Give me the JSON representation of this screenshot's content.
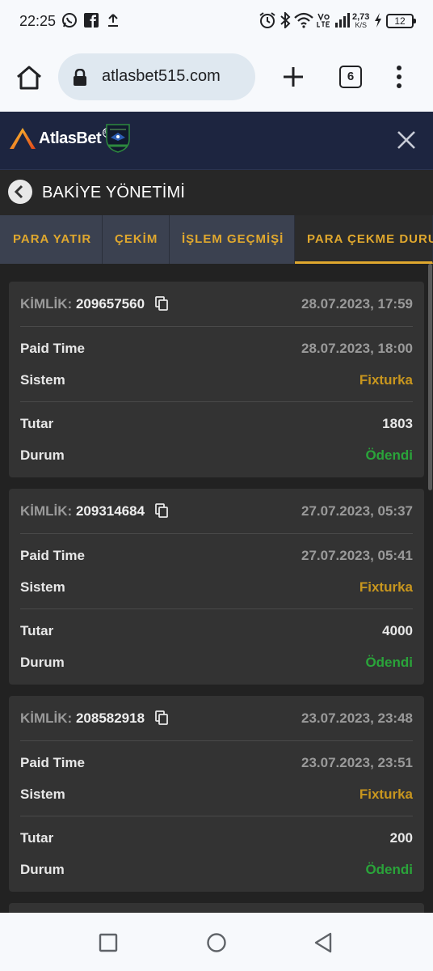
{
  "status_bar": {
    "time": "22:25",
    "net_speed": "2,73",
    "net_unit": "K/S",
    "battery": "12"
  },
  "browser": {
    "url": "atlasbet515.com",
    "tab_count": "6"
  },
  "site": {
    "logo_text": "AtlasBet",
    "logo_badge": "360"
  },
  "page": {
    "title": "BAKİYE YÖNETİMİ"
  },
  "tabs": [
    {
      "label": "PARA YATIR"
    },
    {
      "label": "ÇEKİM"
    },
    {
      "label": "İŞLEM GEÇMİŞİ"
    },
    {
      "label": "PARA ÇEKME DURUMU"
    }
  ],
  "labels": {
    "kimlik": "KİMLİK:",
    "paid_time": "Paid Time",
    "sistem": "Sistem",
    "tutar": "Tutar",
    "durum": "Durum"
  },
  "transactions": [
    {
      "id": "209657560",
      "created": "28.07.2023, 17:59",
      "paid_time": "28.07.2023, 18:00",
      "system": "Fixturka",
      "amount": "1803",
      "status": "Ödendi"
    },
    {
      "id": "209314684",
      "created": "27.07.2023, 05:37",
      "paid_time": "27.07.2023, 05:41",
      "system": "Fixturka",
      "amount": "4000",
      "status": "Ödendi"
    },
    {
      "id": "208582918",
      "created": "23.07.2023, 23:48",
      "paid_time": "23.07.2023, 23:51",
      "system": "Fixturka",
      "amount": "200",
      "status": "Ödendi"
    }
  ],
  "colors": {
    "accent": "#e0a82e",
    "system": "#c8961e",
    "paid": "#2aa43a",
    "header": "#1d2540"
  }
}
